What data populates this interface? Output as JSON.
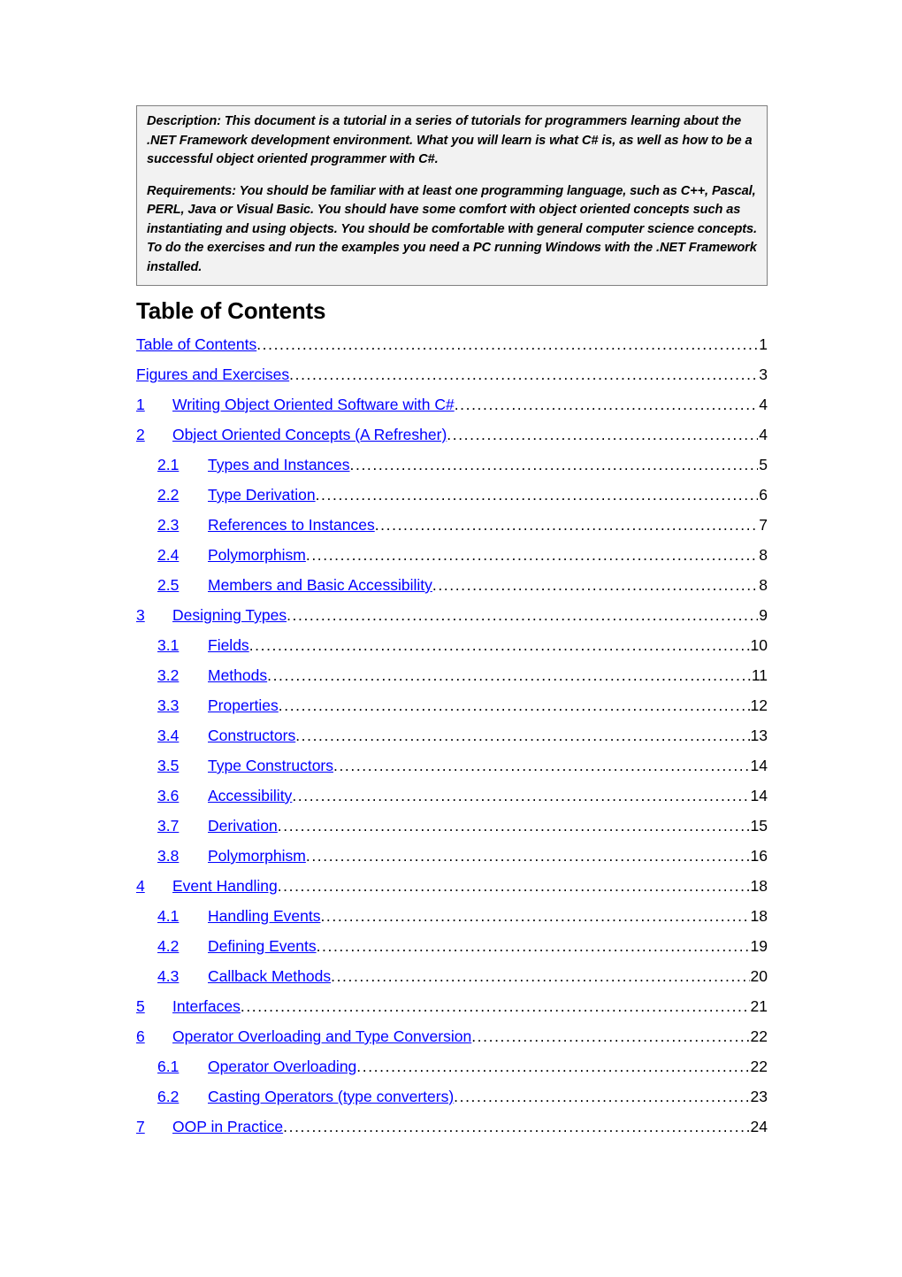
{
  "document": {
    "description_box": {
      "paragraphs": [
        "Description:  This document is a tutorial in a series of tutorials for programmers learning about the .NET Framework development environment.  What you will learn is what C# is, as well as how to be a successful object oriented programmer with C#.",
        "Requirements:  You should be familiar with at least one programming language, such as C++, Pascal, PERL, Java or Visual Basic.  You should have some comfort with object oriented concepts such as instantiating and using objects.  You should be comfortable with general computer science concepts.  To do the exercises and run the examples you need a PC running Windows with the .NET Framework installed."
      ]
    },
    "toc": {
      "heading": "Table of Contents",
      "link_color": "#0000ff",
      "entries": [
        {
          "number": "",
          "title": "Table of Contents",
          "page": "1",
          "level": 1
        },
        {
          "number": "",
          "title": "Figures and Exercises",
          "page": "3",
          "level": 1
        },
        {
          "number": "1",
          "title": "Writing Object Oriented Software with C#",
          "page": "4",
          "level": 1
        },
        {
          "number": "2",
          "title": "Object Oriented Concepts (A Refresher)",
          "page": "4",
          "level": 1
        },
        {
          "number": "2.1",
          "title": "Types and Instances",
          "page": "5",
          "level": 2
        },
        {
          "number": "2.2",
          "title": "Type Derivation",
          "page": "6",
          "level": 2
        },
        {
          "number": "2.3",
          "title": "References to Instances",
          "page": "7",
          "level": 2
        },
        {
          "number": "2.4",
          "title": "Polymorphism",
          "page": "8",
          "level": 2
        },
        {
          "number": "2.5",
          "title": "Members and Basic Accessibility",
          "page": "8",
          "level": 2
        },
        {
          "number": "3",
          "title": "Designing Types",
          "page": "9",
          "level": 1
        },
        {
          "number": "3.1",
          "title": "Fields",
          "page": "10",
          "level": 2
        },
        {
          "number": "3.2",
          "title": "Methods",
          "page": "11",
          "level": 2
        },
        {
          "number": "3.3",
          "title": "Properties",
          "page": "12",
          "level": 2
        },
        {
          "number": "3.4",
          "title": "Constructors",
          "page": "13",
          "level": 2
        },
        {
          "number": "3.5",
          "title": "Type Constructors",
          "page": "14",
          "level": 2
        },
        {
          "number": "3.6",
          "title": "Accessibility",
          "page": "14",
          "level": 2
        },
        {
          "number": "3.7",
          "title": "Derivation",
          "page": "15",
          "level": 2
        },
        {
          "number": "3.8",
          "title": "Polymorphism",
          "page": "16",
          "level": 2
        },
        {
          "number": "4",
          "title": "Event Handling",
          "page": "18",
          "level": 1
        },
        {
          "number": "4.1",
          "title": "Handling Events",
          "page": "18",
          "level": 2
        },
        {
          "number": "4.2",
          "title": "Defining Events",
          "page": "19",
          "level": 2
        },
        {
          "number": "4.3",
          "title": "Callback Methods",
          "page": "20",
          "level": 2
        },
        {
          "number": "5",
          "title": "Interfaces",
          "page": "21",
          "level": 1
        },
        {
          "number": "6",
          "title": "Operator Overloading and Type Conversion",
          "page": "22",
          "level": 1
        },
        {
          "number": "6.1",
          "title": "Operator Overloading",
          "page": "22",
          "level": 2
        },
        {
          "number": "6.2",
          "title": "Casting Operators (type converters)",
          "page": "23",
          "level": 2
        },
        {
          "number": "7",
          "title": "OOP in Practice",
          "page": "24",
          "level": 1
        }
      ]
    }
  }
}
